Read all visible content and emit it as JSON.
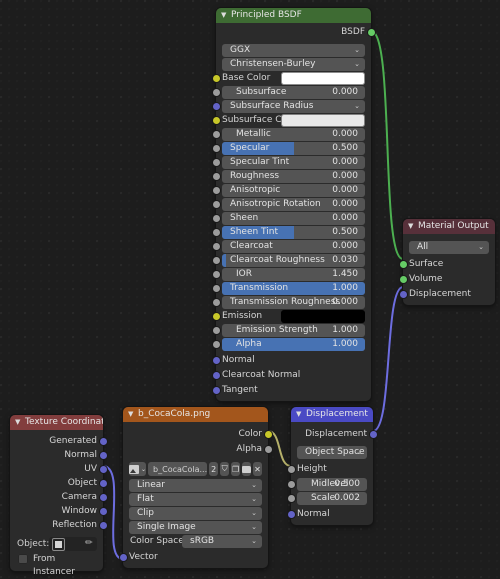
{
  "editor": {
    "name": "blender-shader-node-editor",
    "background": "#1d1d1d"
  },
  "colors": {
    "shader_socket": "#66cc66",
    "vector_socket": "#6363c7",
    "color_socket": "#c7c729",
    "float_socket": "#9c9c9c",
    "slider_fill": "#4772b3",
    "header_shader": "#3e6b33",
    "header_output": "#57303a",
    "header_input": "#823d3d",
    "header_texture": "#a3561c",
    "header_vector": "#4a4ac4"
  },
  "nodes": {
    "principled_bsdf": {
      "title": "Principled BSDF",
      "outputs": [
        {
          "label": "BSDF",
          "socket": "shader"
        }
      ],
      "dropdowns": [
        {
          "name": "distribution",
          "value": "GGX"
        },
        {
          "name": "subsurface-method",
          "value": "Christensen-Burley"
        }
      ],
      "inputs": [
        {
          "label": "Base Color",
          "socket": "color",
          "kind": "swatch",
          "swatch": "#ffffff"
        },
        {
          "label": "Subsurface",
          "socket": "float",
          "kind": "slider",
          "value": "0.000",
          "fill": 0,
          "indent": true
        },
        {
          "label": "Subsurface Radius",
          "socket": "vector",
          "kind": "dropdown"
        },
        {
          "label": "Subsurface Color",
          "socket": "color",
          "kind": "swatch",
          "swatch": "#e9e9e9"
        },
        {
          "label": "Metallic",
          "socket": "float",
          "kind": "slider",
          "value": "0.000",
          "fill": 0,
          "indent": true
        },
        {
          "label": "Specular",
          "socket": "float",
          "kind": "slider",
          "value": "0.500",
          "fill": 50
        },
        {
          "label": "Specular Tint",
          "socket": "float",
          "kind": "slider",
          "value": "0.000",
          "fill": 0
        },
        {
          "label": "Roughness",
          "socket": "float",
          "kind": "slider",
          "value": "0.000",
          "fill": 0
        },
        {
          "label": "Anisotropic",
          "socket": "float",
          "kind": "slider",
          "value": "0.000",
          "fill": 0
        },
        {
          "label": "Anisotropic Rotation",
          "socket": "float",
          "kind": "slider",
          "value": "0.000",
          "fill": 0
        },
        {
          "label": "Sheen",
          "socket": "float",
          "kind": "slider",
          "value": "0.000",
          "fill": 0
        },
        {
          "label": "Sheen Tint",
          "socket": "float",
          "kind": "slider",
          "value": "0.500",
          "fill": 50
        },
        {
          "label": "Clearcoat",
          "socket": "float",
          "kind": "slider",
          "value": "0.000",
          "fill": 0
        },
        {
          "label": "Clearcoat Roughness",
          "socket": "float",
          "kind": "slider",
          "value": "0.030",
          "fill": 3
        },
        {
          "label": "IOR",
          "socket": "float",
          "kind": "slider",
          "value": "1.450",
          "fill": 0,
          "indent": true
        },
        {
          "label": "Transmission",
          "socket": "float",
          "kind": "slider",
          "value": "1.000",
          "fill": 100
        },
        {
          "label": "Transmission Roughness",
          "socket": "float",
          "kind": "slider",
          "value": "0.000",
          "fill": 0
        },
        {
          "label": "Emission",
          "socket": "color",
          "kind": "swatch",
          "swatch": "#000000"
        },
        {
          "label": "Emission Strength",
          "socket": "float",
          "kind": "slider",
          "value": "1.000",
          "fill": 0,
          "indent": true
        },
        {
          "label": "Alpha",
          "socket": "float",
          "kind": "slider",
          "value": "1.000",
          "fill": 100,
          "indent": true
        },
        {
          "label": "Normal",
          "socket": "vector",
          "kind": "plain"
        },
        {
          "label": "Clearcoat Normal",
          "socket": "vector",
          "kind": "plain"
        },
        {
          "label": "Tangent",
          "socket": "vector",
          "kind": "plain"
        }
      ]
    },
    "material_output": {
      "title": "Material Output",
      "dropdown": {
        "name": "target",
        "value": "All"
      },
      "inputs": [
        {
          "label": "Surface",
          "socket": "shader"
        },
        {
          "label": "Volume",
          "socket": "shader"
        },
        {
          "label": "Displacement",
          "socket": "vector"
        }
      ]
    },
    "texture_coordinate": {
      "title": "Texture Coordinate",
      "outputs": [
        {
          "label": "Generated",
          "socket": "vector"
        },
        {
          "label": "Normal",
          "socket": "vector"
        },
        {
          "label": "UV",
          "socket": "vector"
        },
        {
          "label": "Object",
          "socket": "vector"
        },
        {
          "label": "Camera",
          "socket": "vector"
        },
        {
          "label": "Window",
          "socket": "vector"
        },
        {
          "label": "Reflection",
          "socket": "vector"
        }
      ],
      "object_label": "Object:",
      "object_value": "",
      "from_instancer_label": "From Instancer",
      "from_instancer_checked": false
    },
    "image_texture": {
      "title": "b_CocaCola.png",
      "outputs": [
        {
          "label": "Color",
          "socket": "color"
        },
        {
          "label": "Alpha",
          "socket": "float"
        }
      ],
      "datablock": {
        "browse_icon": "image-datablock-icon",
        "name": "b_CocaCola...",
        "users": "2",
        "shield_icon": "fake-user-icon",
        "copy_icon": "new-copy-icon",
        "open_icon": "open-folder-icon",
        "unlink_icon": "unlink-x-icon"
      },
      "dropdowns": [
        {
          "name": "interpolation",
          "value": "Linear"
        },
        {
          "name": "projection",
          "value": "Flat"
        },
        {
          "name": "extension",
          "value": "Clip"
        },
        {
          "name": "source",
          "value": "Single Image"
        }
      ],
      "color_space_label": "Color Space",
      "color_space_value": "sRGB",
      "inputs": [
        {
          "label": "Vector",
          "socket": "vector"
        }
      ]
    },
    "displacement": {
      "title": "Displacement",
      "outputs": [
        {
          "label": "Displacement",
          "socket": "vector"
        }
      ],
      "dropdown": {
        "name": "space",
        "value": "Object Space"
      },
      "inputs": [
        {
          "label": "Height",
          "socket": "float",
          "kind": "plain"
        },
        {
          "label": "Midlevel",
          "socket": "float",
          "kind": "slider",
          "value": "0.500",
          "indent": true
        },
        {
          "label": "Scale",
          "socket": "float",
          "kind": "slider",
          "value": "0.002",
          "indent": true
        },
        {
          "label": "Normal",
          "socket": "vector",
          "kind": "plain"
        }
      ]
    }
  },
  "links": [
    {
      "from": "principled_bsdf.BSDF",
      "to": "material_output.Surface",
      "color": "#4caf50"
    },
    {
      "from": "displacement.Displacement",
      "to": "material_output.Displacement",
      "color": "#6d6de0"
    },
    {
      "from": "texture_coordinate.UV",
      "to": "image_texture.Vector",
      "color": "#6d6de0"
    },
    {
      "from": "image_texture.Color",
      "to": "displacement.Height",
      "color": "#b5b06a"
    }
  ]
}
